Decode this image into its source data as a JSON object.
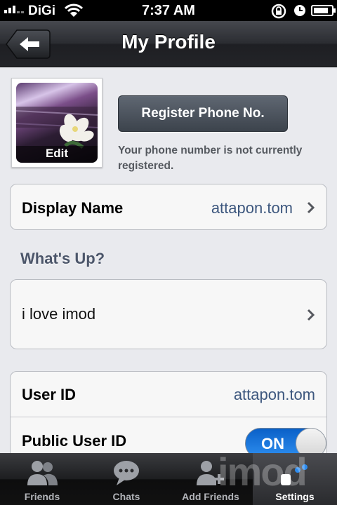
{
  "status_bar": {
    "carrier": "DiGi",
    "time": "7:37 AM"
  },
  "nav": {
    "title": "My Profile"
  },
  "profile_photo": {
    "edit_label": "Edit"
  },
  "phone": {
    "register_button": "Register Phone No.",
    "note_line1": "Your phone number is not currently",
    "note_line2": "registered."
  },
  "display_name": {
    "label": "Display Name",
    "value": "attapon.tom"
  },
  "whats_up": {
    "section_title": "What's Up?",
    "text": "i love imod"
  },
  "user_id": {
    "label": "User ID",
    "value": "attapon.tom"
  },
  "public_user_id": {
    "label": "Public User ID",
    "toggle_state": "ON"
  },
  "tabs": [
    {
      "label": "Friends",
      "icon": "friends-icon"
    },
    {
      "label": "Chats",
      "icon": "chats-icon"
    },
    {
      "label": "Add Friends",
      "icon": "add-friend-icon"
    },
    {
      "label": "Settings",
      "icon": "settings-icon",
      "selected": true
    }
  ],
  "watermark": "imod",
  "colors": {
    "accent_blue": "#2e8ff0",
    "link_value": "#3d577e",
    "nav_dark": "#2b2d32"
  }
}
